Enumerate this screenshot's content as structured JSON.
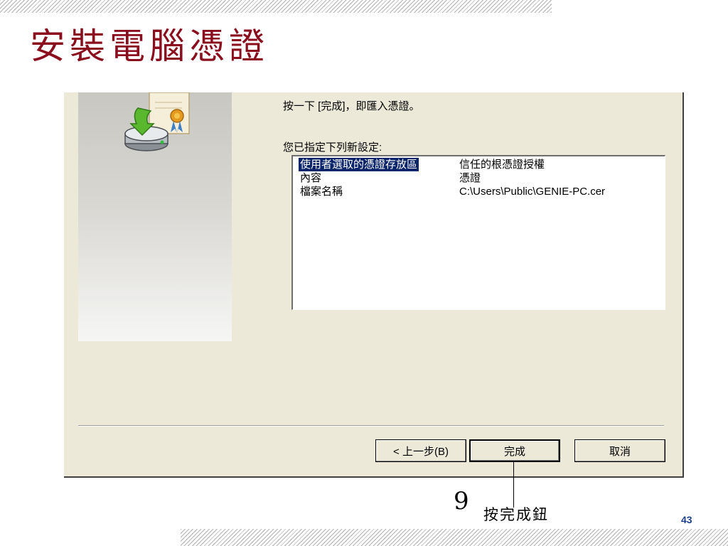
{
  "slide": {
    "title": "安裝電腦憑證",
    "page_number": "43"
  },
  "dialog": {
    "instruction": "按一下 [完成]，即匯入憑證。",
    "settings_label": "您已指定下列新設定:",
    "settings": [
      {
        "key": "使用者選取的憑證存放區",
        "value": "信任的根憑證授權",
        "selected": true
      },
      {
        "key": "內容",
        "value": "憑證",
        "selected": false
      },
      {
        "key": "檔案名稱",
        "value": "C:\\Users\\Public\\GENIE-PC.cer",
        "selected": false
      }
    ],
    "buttons": {
      "back": "< 上一步(B)",
      "finish": "完成",
      "cancel": "取消"
    },
    "selection_color": "#0a246a"
  },
  "annotation": {
    "step_number": "9",
    "text": "按完成鈕"
  },
  "icons": [
    "certificate-drive-icon"
  ],
  "colors": {
    "title": "#8b0e1f",
    "page_number": "#1c3f8a",
    "dialog_bg": "#ece9d8"
  }
}
